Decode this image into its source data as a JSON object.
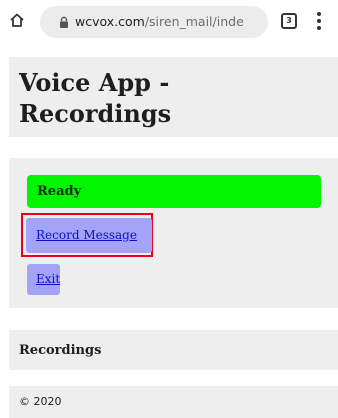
{
  "browser": {
    "url_host": "wcvox.com",
    "url_path": "/siren_mail/inde",
    "tab_count": "3",
    "icons": {
      "home": "home-icon",
      "lock": "lock-icon",
      "tabs": "tabs-icon",
      "menu": "overflow-menu-icon"
    }
  },
  "header": {
    "title": "Voice App - Recordings"
  },
  "main": {
    "status_text": "Ready",
    "record_button_label": "Record Message",
    "exit_button_label": "Exit"
  },
  "recordings": {
    "heading": "Recordings"
  },
  "footer": {
    "text": "© 2020"
  },
  "colors": {
    "status_background": "#00f500",
    "button_background": "#a3a3fa",
    "link_text": "#0f0fc8",
    "panel_background": "#eeeeee",
    "highlight_border": "#e8001c"
  }
}
